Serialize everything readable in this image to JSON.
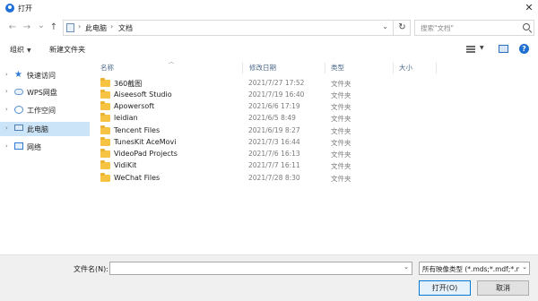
{
  "window": {
    "title": "打开",
    "close_glyph": "✕"
  },
  "nav": {
    "back_glyph": "←",
    "forward_glyph": "→",
    "dropdown_glyph": "⌄",
    "up_glyph": "↑",
    "breadcrumbs": [
      "此电脑",
      "文档"
    ],
    "sep_glyph": "›",
    "refresh_glyph": "↻",
    "search_placeholder": "搜索\"文档\""
  },
  "toolbar": {
    "organize_label": "组织",
    "organize_caret": "▼",
    "new_folder_label": "新建文件夹",
    "view_caret": "▼",
    "help_glyph": "?"
  },
  "sidebar": {
    "items": [
      {
        "label": "快速访问",
        "icon": "star-icon"
      },
      {
        "label": "WPS网盘",
        "icon": "cloud-icon"
      },
      {
        "label": "工作空间",
        "icon": "workspace-icon"
      },
      {
        "label": "此电脑",
        "icon": "computer-icon",
        "selected": true
      },
      {
        "label": "网络",
        "icon": "network-icon"
      }
    ],
    "chevron_glyph": "›"
  },
  "filelist": {
    "sort_glyph": "︿",
    "columns": {
      "name": "名称",
      "date": "修改日期",
      "type": "类型",
      "size": "大小"
    },
    "rows": [
      {
        "name": "360截图",
        "date": "2021/7/27 17:52",
        "type": "文件夹"
      },
      {
        "name": "Aiseesoft Studio",
        "date": "2021/7/19 16:40",
        "type": "文件夹"
      },
      {
        "name": "Apowersoft",
        "date": "2021/6/6 17:19",
        "type": "文件夹"
      },
      {
        "name": "leidian",
        "date": "2021/6/5 8:49",
        "type": "文件夹"
      },
      {
        "name": "Tencent Files",
        "date": "2021/6/19 8:27",
        "type": "文件夹"
      },
      {
        "name": "TunesKit AceMovi",
        "date": "2021/7/3 16:44",
        "type": "文件夹"
      },
      {
        "name": "VideoPad Projects",
        "date": "2021/7/6 16:13",
        "type": "文件夹"
      },
      {
        "name": "VidiKit",
        "date": "2021/7/7 16:11",
        "type": "文件夹"
      },
      {
        "name": "WeChat Files",
        "date": "2021/7/28 8:30",
        "type": "文件夹"
      }
    ]
  },
  "bottom": {
    "filename_label": "文件名(N):",
    "filename_value": "",
    "dropdown_glyph": "⌄",
    "filter_value": "所有映像类型 (*.mds;*.mdf;*.n",
    "open_label": "打开(O)",
    "cancel_label": "取消"
  }
}
